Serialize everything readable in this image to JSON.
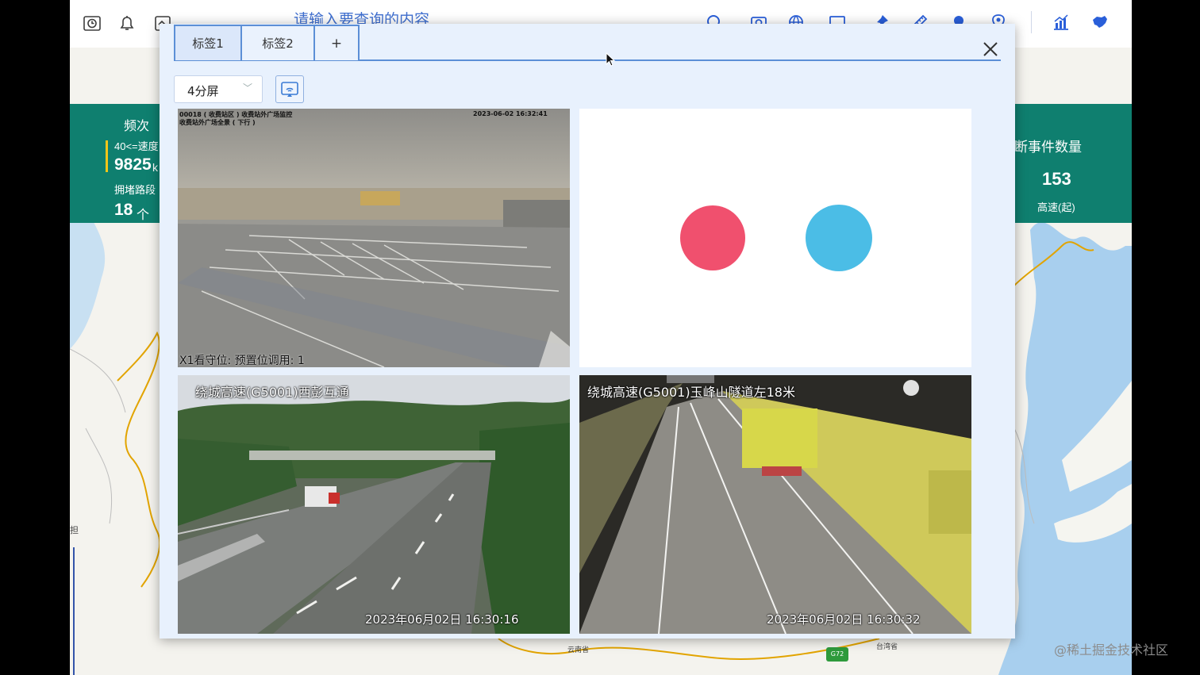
{
  "toolbar": {
    "search_placeholder": "请输入要查询的内容",
    "left_icons": [
      "clock-icon",
      "bell-icon",
      "calendar-icon"
    ],
    "right_icons": [
      "search-icon",
      "camera-icon",
      "globe-icon",
      "monitor-icon",
      "pin-icon",
      "ruler-icon",
      "location-icon",
      "map-pin-icon",
      "chart-icon",
      "china-map-icon"
    ]
  },
  "stats_left": {
    "frequency_label": "频次",
    "speed_label": "40<=速度",
    "speed_value": "9825",
    "speed_unit": "k",
    "congestion_label": "拥堵路段",
    "congestion_value": "18",
    "congestion_unit": "个"
  },
  "stats_right": {
    "title": "断事件数量",
    "value": "153",
    "sub_label": "高速(起)"
  },
  "map": {
    "labels": [
      "云南省",
      "台湾省"
    ],
    "road_badge": "G72",
    "left_edge_char": "担"
  },
  "modal": {
    "tabs": [
      {
        "label": "标签1",
        "active": true
      },
      {
        "label": "标签2",
        "active": false
      }
    ],
    "add_tab_label": "+",
    "close_icon": "close-icon",
    "layout_select": {
      "value": "4分屏"
    },
    "cast_icon": "cast-screen-icon",
    "cells": [
      {
        "top_text_1": "00018 ( 收费站区 ) 收费站外广场监控",
        "top_text_2": "收费站外广场全景 ( 下行 )",
        "timestamp": "2023-06-02 16:32:41",
        "bottom_text": "X1看守位: 预置位调用: 1"
      },
      {
        "loading_colors": [
          "#f0506e",
          "#4bbde6"
        ]
      },
      {
        "title": "绕城高速(G5001)西彭互通",
        "timestamp": "2023年06月02日 16:30:16"
      },
      {
        "title": "绕城高速(G5001)玉峰山隧道左18米",
        "timestamp": "2023年06月02日 16:30:32"
      }
    ]
  },
  "watermark": "@稀土掘金技术社区"
}
